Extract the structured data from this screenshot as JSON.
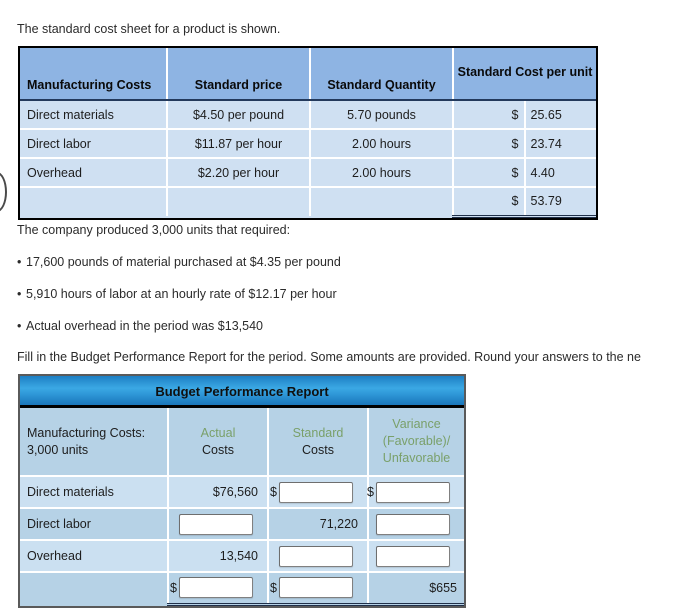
{
  "intro": {
    "line1": "The standard cost sheet for a product is shown.",
    "produced": "The company produced 3,000 units that required:",
    "bullets": [
      "17,600 pounds of material purchased at $4.35 per pound",
      "5,910 hours of labor at an hourly rate of $12.17 per hour",
      "Actual overhead in the period was $13,540"
    ],
    "bullet_marker": "•",
    "fill_in": "Fill in the Budget Performance Report for the period. Some amounts are provided. Round your answers to the ne"
  },
  "cost_sheet": {
    "headers": {
      "col1": "Manufacturing Costs",
      "col2": "Standard price",
      "col3": "Standard Quantity",
      "col4_line1": "Standard Cost",
      "col4_line2": "per unit"
    },
    "rows": [
      {
        "name": "Direct materials",
        "price": "$4.50 per pound",
        "quantity": "5.70 pounds",
        "currency": "$",
        "unit_cost": "25.65"
      },
      {
        "name": "Direct labor",
        "price": "$11.87 per hour",
        "quantity": "2.00 hours",
        "currency": "$",
        "unit_cost": "23.74"
      },
      {
        "name": "Overhead",
        "price": "$2.20 per hour",
        "quantity": "2.00 hours",
        "currency": "$",
        "unit_cost": "4.40"
      },
      {
        "name": "",
        "price": "",
        "quantity": "",
        "currency": "$",
        "unit_cost": "53.79"
      }
    ]
  },
  "budget_report": {
    "title": "Budget Performance Report",
    "headers": {
      "col1_line1": "Manufacturing Costs:",
      "col1_line2": "3,000 units",
      "col2_line1": "Actual",
      "col2_line2": "Costs",
      "col3_line1": "Standard",
      "col3_line2": "Costs",
      "col4_line1": "Variance",
      "col4_line2": "(Favorable)/",
      "col4_line3": "Unfavorable"
    },
    "rows": [
      {
        "name": "Direct materials",
        "actual_value": "$76,560",
        "actual_is_input": false,
        "actual_currency": "",
        "standard_value": "",
        "standard_is_input": true,
        "standard_currency": "$",
        "variance_value": "",
        "variance_is_input": true,
        "variance_currency": "$"
      },
      {
        "name": "Direct labor",
        "actual_value": "",
        "actual_is_input": true,
        "actual_currency": "",
        "standard_value": "71,220",
        "standard_is_input": false,
        "standard_currency": "",
        "variance_value": "",
        "variance_is_input": true,
        "variance_currency": ""
      },
      {
        "name": "Overhead",
        "actual_value": "13,540",
        "actual_is_input": false,
        "actual_currency": "",
        "standard_value": "",
        "standard_is_input": true,
        "standard_currency": "",
        "variance_value": "",
        "variance_is_input": true,
        "variance_currency": ""
      },
      {
        "name": "",
        "actual_value": "",
        "actual_is_input": true,
        "actual_currency": "$",
        "standard_value": "",
        "standard_is_input": true,
        "standard_currency": "$",
        "variance_value": "$655",
        "variance_is_input": false,
        "variance_currency": ""
      }
    ]
  },
  "colors": {
    "table1_header_bg": "#8eb4e3",
    "table1_body_bg": "#cfe0f2",
    "bpr_title_blue": "#2f98d8",
    "bpr_row_light": "#cbe0f1",
    "bpr_row_dark": "#b6d2e6",
    "header_green_text": "#7aa06a",
    "rule_navy": "#20304a"
  }
}
